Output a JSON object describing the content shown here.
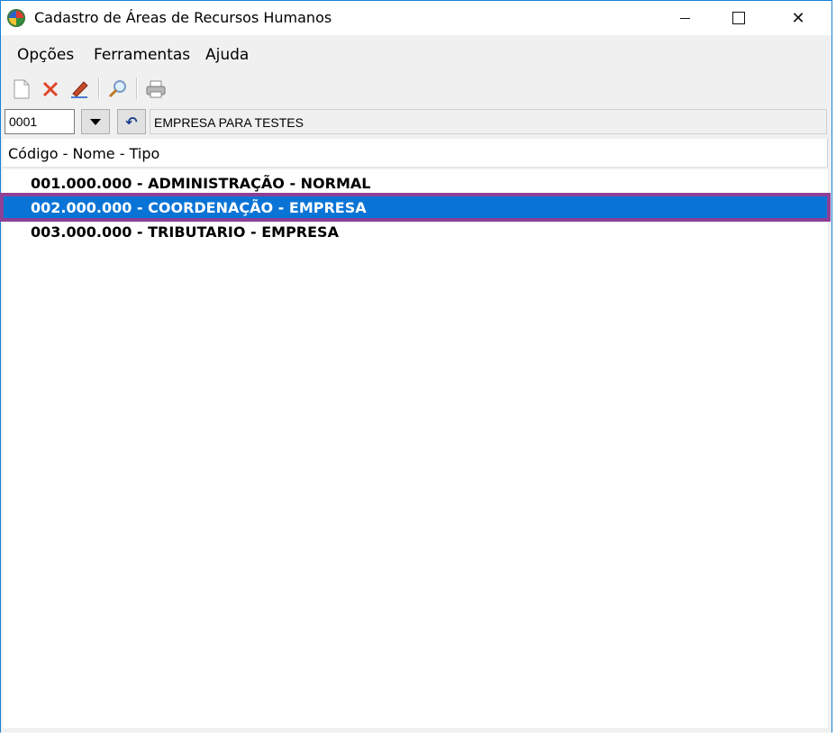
{
  "window": {
    "title": "Cadastro de Áreas de Recursos Humanos"
  },
  "menu": {
    "items": [
      "Opções",
      "Ferramentas",
      "Ajuda"
    ]
  },
  "toolbar": {
    "icons": [
      "new-document-icon",
      "delete-icon",
      "edit-icon",
      "search-icon",
      "print-icon"
    ]
  },
  "filter": {
    "code_value": "0001",
    "company_name": "EMPRESA PARA TESTES"
  },
  "list": {
    "header": "Código - Nome - Tipo",
    "rows": [
      "001.000.000 - ADMINISTRAÇÃO - NORMAL",
      "002.000.000 - COORDENAÇÃO - EMPRESA",
      "003.000.000 - TRIBUTARIO - EMPRESA"
    ],
    "selected_index": 1
  },
  "colors": {
    "selection": "#0a74d6",
    "highlight_outline": "#8e3f96",
    "window_border": "#1883d7"
  }
}
